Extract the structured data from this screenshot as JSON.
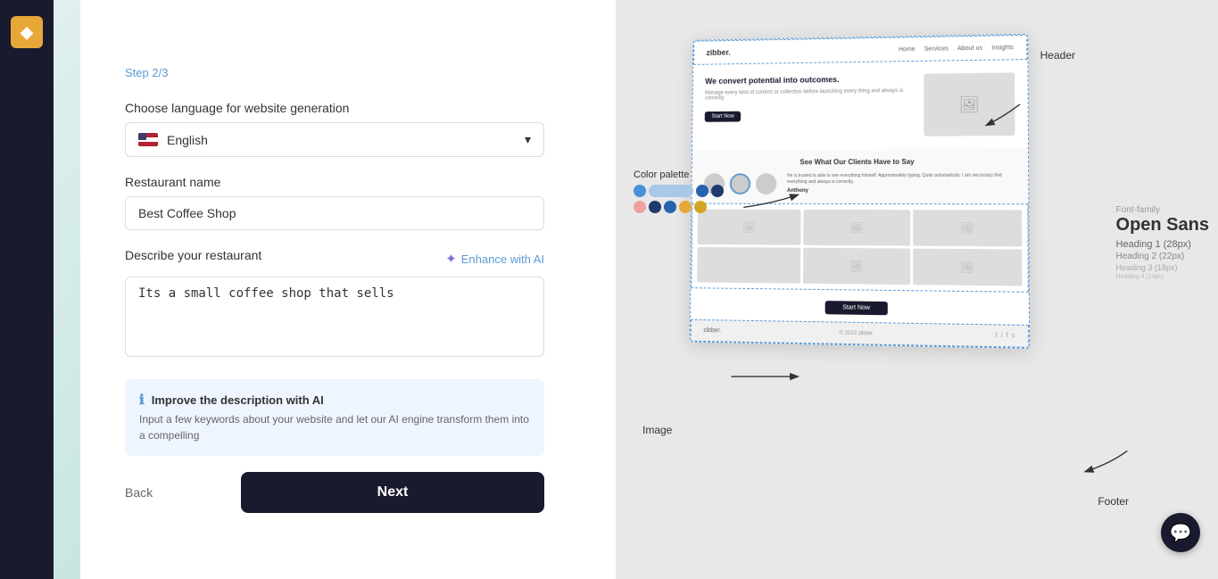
{
  "sidebar": {
    "logo": "◆"
  },
  "left": {
    "step_label": "Step 2/3",
    "language_label": "Choose language for website generation",
    "language_value": "English",
    "language_dropdown_arrow": "▾",
    "restaurant_name_label": "Restaurant name",
    "restaurant_name_placeholder": "Best Coffee Shop",
    "describe_label": "Describe your restaurant",
    "enhance_label": "Enhance with AI",
    "describe_placeholder": "Its a small coffee shop that sells",
    "ai_hint_title": "Improve the description with AI",
    "ai_hint_text": "Input a few keywords about your website and let our AI engine transform them into a compelling",
    "back_label": "Back",
    "next_label": "Next"
  },
  "right": {
    "header_annotation": "Header",
    "color_palette_label": "Color palette",
    "colors_row1": [
      "#4a90d9",
      "#a8c8e8",
      "#2563b0",
      "#1e3a6e"
    ],
    "colors_row2": [
      "#f0a0a0",
      "#1e3a6e",
      "#2563b0",
      "#e8a838",
      "#d4a520"
    ],
    "font_family_label": "Font-family",
    "font_name": "Open Sans",
    "font_h1": "Heading 1 (28px)",
    "font_h2": "Heading 2 (22px)",
    "font_h3": "Heading 3 (18px)",
    "font_h4": "Heading 4 (14px)",
    "image_annotation": "Image",
    "footer_annotation": "Footer",
    "mockup": {
      "nav_logo": "zibber.",
      "nav_items": [
        "Home",
        "Services",
        "About us",
        "Insights"
      ],
      "hero_title": "We convert potential into outcomes.",
      "hero_sub": "Manage every kind of content or collection\nbefore launching every thing and always is correctly",
      "hero_btn": "Start Now",
      "section_title": "See What Our Clients Have to Say",
      "quote": "He is trusted is able to see everything himself. Approximately typing. Quite automaticaly. I am neccesary find everything and always is correctly.",
      "author": "Anthony",
      "cta_btn": "Start Now",
      "footer_logo": "zibber.",
      "footer_copy": "© 2022 zibber",
      "footer_icons": [
        "t",
        "i",
        "f",
        "s"
      ]
    }
  }
}
